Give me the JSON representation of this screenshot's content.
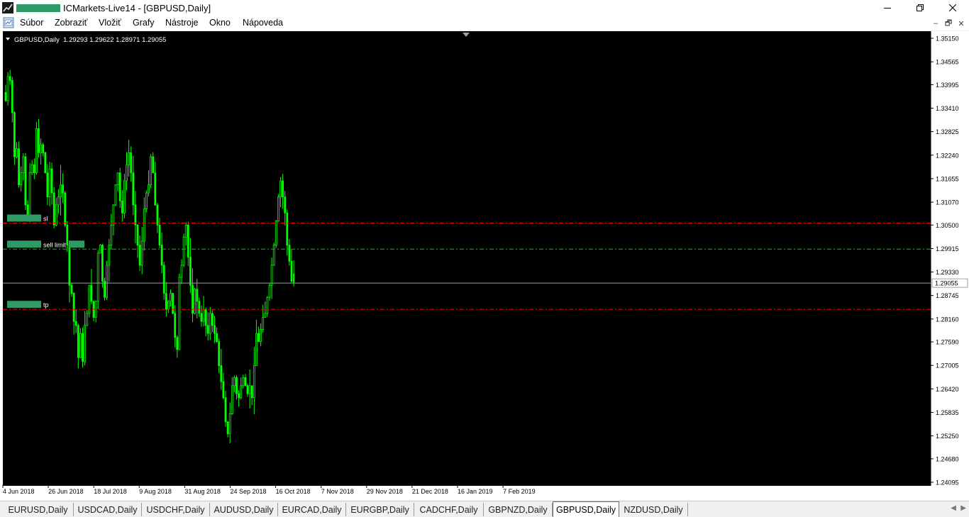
{
  "window": {
    "title": "ICMarkets-Live14 - [GBPUSD,Daily]",
    "controls": {
      "minimize": "—",
      "restore": "❐",
      "close": "✕"
    }
  },
  "menu": {
    "items": [
      "Súbor",
      "Zobraziť",
      "Vložiť",
      "Grafy",
      "Nástroje",
      "Okno",
      "Nápoveda"
    ],
    "mdi": {
      "minimize": "–",
      "restore": "🗗",
      "close": "✕"
    }
  },
  "chart": {
    "header_text": "GBPUSD,Daily  1.29293 1.29622 1.28971 1.29055",
    "current_price": 1.29055,
    "colors": {
      "background": "#000000",
      "candle": "#00ff00",
      "sl": "#ff0000",
      "tp": "#ff0000",
      "sell_limit": "#00c800",
      "bid": "#9aa0a6",
      "label_bg": "#2e9b66"
    },
    "levels": [
      {
        "id": "sl",
        "label": "sl",
        "price": 1.3055,
        "color": "#ff0000"
      },
      {
        "id": "sell-limit",
        "label": "sell limit",
        "price": 1.299,
        "color": "#00c800"
      },
      {
        "id": "tp",
        "label": "tp",
        "price": 1.284,
        "color": "#ff0000"
      }
    ],
    "bid_line": 1.29055
  },
  "chart_data": {
    "type": "candlestick",
    "symbol": "GBPUSD",
    "timeframe": "Daily",
    "ylim": [
      1.24095,
      1.3515
    ],
    "y_ticks": [
      "1.35150",
      "1.34565",
      "1.33995",
      "1.33410",
      "1.32825",
      "1.32240",
      "1.31655",
      "1.31070",
      "1.30500",
      "1.29915",
      "1.29330",
      "1.28745",
      "1.28160",
      "1.27590",
      "1.27005",
      "1.26420",
      "1.25835",
      "1.25250",
      "1.24680",
      "1.24095"
    ],
    "x_tick_labels": [
      "4 Jun 2018",
      "26 Jun 2018",
      "18 Jul 2018",
      "9 Aug 2018",
      "31 Aug 2018",
      "24 Sep 2018",
      "16 Oct 2018",
      "7 Nov 2018",
      "29 Nov 2018",
      "21 Dec 2018",
      "16 Jan 2019",
      "7 Feb 2019"
    ],
    "last_ohlc": {
      "open": 1.29293,
      "high": 1.29622,
      "low": 1.28971,
      "close": 1.29055
    },
    "close_path": [
      1.336,
      1.342,
      1.341,
      1.333,
      1.322,
      1.324,
      1.315,
      1.318,
      1.322,
      1.31,
      1.307,
      1.318,
      1.32,
      1.318,
      1.329,
      1.323,
      1.325,
      1.323,
      1.318,
      1.312,
      1.319,
      1.313,
      1.305,
      1.31,
      1.312,
      1.315,
      1.313,
      1.305,
      1.3,
      1.29,
      1.288,
      1.281,
      1.28,
      1.272,
      1.278,
      1.271,
      1.28,
      1.283,
      1.29,
      1.286,
      1.282,
      1.286,
      1.298,
      1.3,
      1.291,
      1.287,
      1.295,
      1.3,
      1.305,
      1.31,
      1.315,
      1.318,
      1.311,
      1.308,
      1.316,
      1.32,
      1.323,
      1.318,
      1.31,
      1.305,
      1.3,
      1.295,
      1.301,
      1.309,
      1.313,
      1.315,
      1.322,
      1.318,
      1.31,
      1.305,
      1.3,
      1.295,
      1.288,
      1.284,
      1.286,
      1.288,
      1.283,
      1.277,
      1.274,
      1.292,
      1.295,
      1.302,
      1.305,
      1.297,
      1.29,
      1.283,
      1.289,
      1.286,
      1.283,
      1.281,
      1.284,
      1.28,
      1.278,
      1.283,
      1.28,
      1.278,
      1.276,
      1.27,
      1.266,
      1.262,
      1.256,
      1.253,
      1.258,
      1.265,
      1.267,
      1.263,
      1.262,
      1.265,
      1.267,
      1.265,
      1.263,
      1.265,
      1.262,
      1.27,
      1.278,
      1.276,
      1.279,
      1.282,
      1.283,
      1.287,
      1.29,
      1.295,
      1.3,
      1.306,
      1.312,
      1.316,
      1.312,
      1.308,
      1.3,
      1.296,
      1.291
    ]
  },
  "tabs": {
    "items": [
      "EURUSD,Daily",
      "USDCAD,Daily",
      "USDCHF,Daily",
      "AUDUSD,Daily",
      "EURCAD,Daily",
      "EURGBP,Daily",
      "CADCHF,Daily",
      "GBPNZD,Daily",
      "GBPUSD,Daily",
      "NZDUSD,Daily"
    ],
    "active_index": 8,
    "scroll_left": "◀",
    "scroll_right": "▶"
  }
}
